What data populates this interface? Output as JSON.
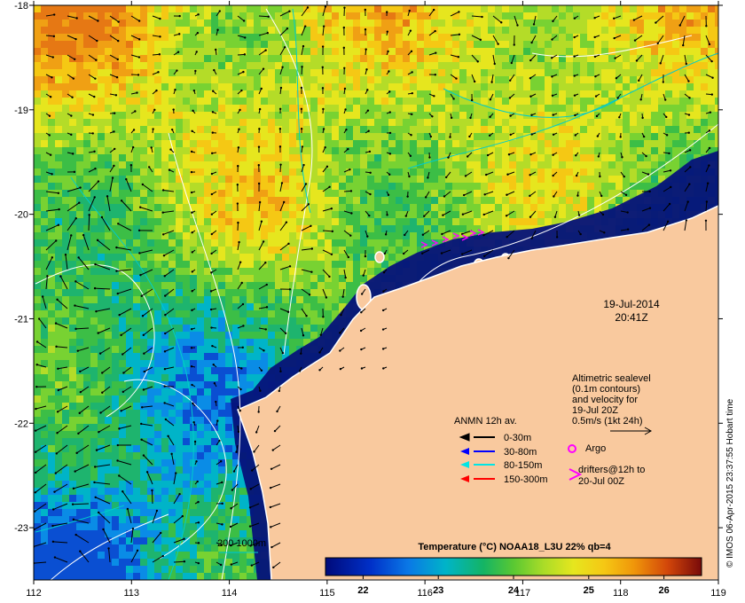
{
  "map": {
    "lon_range": [
      112,
      119
    ],
    "lat_range": [
      -23.5,
      -18
    ],
    "x_ticks": [
      "112",
      "113",
      "114",
      "115",
      "116",
      "117",
      "118",
      "119"
    ],
    "y_ticks": [
      "-18",
      "-19",
      "-20",
      "-21",
      "-22",
      "-23"
    ],
    "land_color": "#f9c99e",
    "coast_color": "#ffffff"
  },
  "timestamp": {
    "date": "19-Jul-2014",
    "time": "20:41Z"
  },
  "altimetry_note": {
    "lines": [
      "Altimetric sealevel",
      "(0.1m contours)",
      "and velocity for",
      "19-Jul 20Z",
      "0.5m/s (1kt 24h)"
    ]
  },
  "anmn_legend": {
    "title": "ANMN 12h av.",
    "items": [
      {
        "label": "0-30m",
        "color": "#000000"
      },
      {
        "label": "30-80m",
        "color": "#0000ff"
      },
      {
        "label": "80-150m",
        "color": "#00e5e5"
      },
      {
        "label": "150-300m",
        "color": "#ff0000"
      }
    ]
  },
  "argo": {
    "label": "Argo",
    "color": "#ff00ff"
  },
  "drifters": {
    "line1": "drifters@12h to",
    "line2": "20-Jul 00Z",
    "color": "#ff00ff"
  },
  "depth_contours": {
    "label": "200  1000m",
    "color": "#00cccc"
  },
  "colorbar": {
    "title": "Temperature (°C) NOAA18_L3U 22% qb=4",
    "ticks": [
      "22",
      "23",
      "24",
      "25",
      "26"
    ],
    "range": [
      21.5,
      26.5
    ]
  },
  "credit": "© IMOS 06-Apr-2015 23:37:55 Hobart time"
}
